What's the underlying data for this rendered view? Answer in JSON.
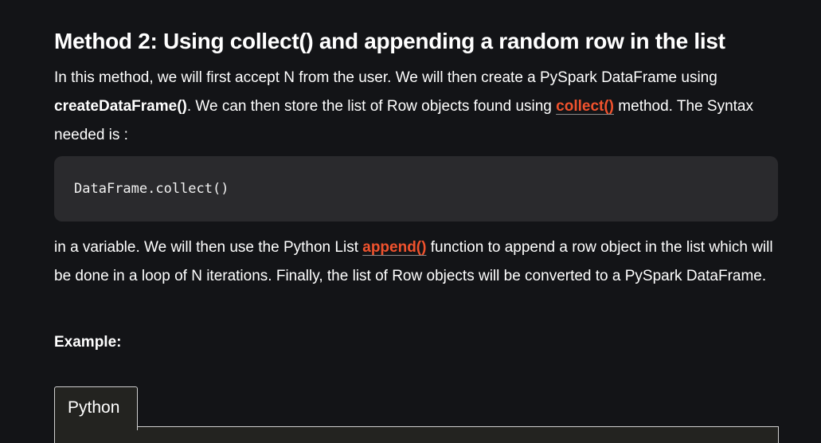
{
  "heading": "Method 2: Using collect() and appending a random row in the list",
  "para1": {
    "t1": "In this method, we will first accept N from the user. We will then create a PySpark DataFrame using ",
    "bold": "createDataFrame()",
    "t2": ". We can then store the list of Row objects found using ",
    "link": "collect()",
    "t3": " method. The Syntax needed is :"
  },
  "code": "DataFrame.collect()",
  "para2": {
    "t1": "in a variable. We will then use the Python List ",
    "link": "append()",
    "t2": " function to append a row object in the list which will be done in a loop of N iterations. Finally, the list of Row objects will be converted to a PySpark DataFrame."
  },
  "example_label": "Example:",
  "tab_label": "Python",
  "colors": {
    "link": "#f0522d",
    "background": "#131417",
    "code_bg": "#2a2a2d"
  }
}
